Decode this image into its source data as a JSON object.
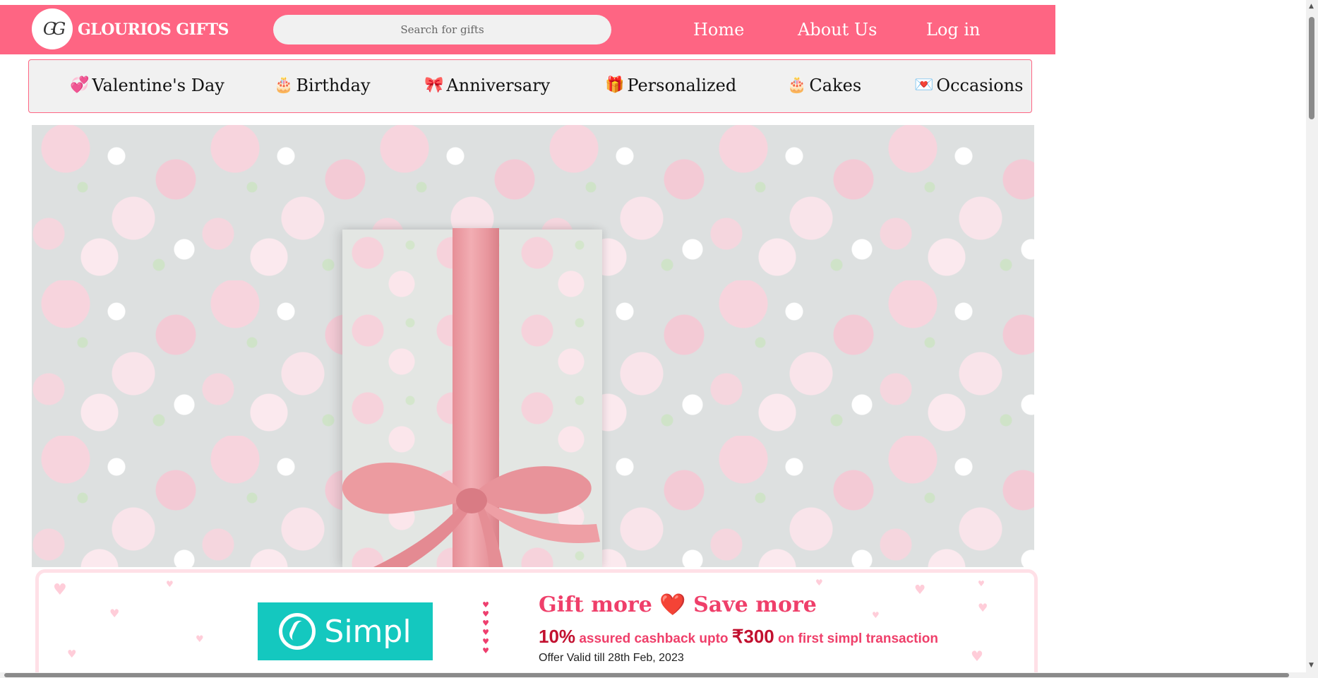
{
  "header": {
    "logo_monogram": "GG",
    "brand_name": "GLOURIOS GIFTS",
    "search_placeholder": "Search for gifts",
    "nav": [
      "Home",
      "About Us",
      "Log in"
    ]
  },
  "categories": [
    {
      "icon": "💞",
      "icon_name": "hearts-icon",
      "label": "Valentine's Day"
    },
    {
      "icon": "🎂",
      "icon_name": "cake-icon",
      "label": "Birthday"
    },
    {
      "icon": "🎀",
      "icon_name": "ribbon-icon",
      "label": "Anniversary"
    },
    {
      "icon": "🎁",
      "icon_name": "gift-icon",
      "label": "Personalized"
    },
    {
      "icon": "🎂",
      "icon_name": "cake-icon",
      "label": "Cakes"
    },
    {
      "icon": "💌",
      "icon_name": "love-letter-icon",
      "label": "Occasions"
    }
  ],
  "hero": {
    "image_name": "gift-box-with-pink-ribbon-on-floral-background"
  },
  "promo": {
    "simpl_logo_text": "Simpl",
    "title_left": "Gift more",
    "title_heart": "❤️",
    "title_right": "Save more",
    "cashback_percent": "10%",
    "cashback_text": "assured cashback upto",
    "cashback_amount": "₹300",
    "cashback_suffix": "on first simpl transaction",
    "valid_text": "Offer Valid till 28th Feb, 2023"
  },
  "colors": {
    "brand_pink": "#fe6583",
    "category_bg": "#f1f1f1",
    "simpl_teal": "#14c8bf",
    "promo_pink": "#ef3f6a"
  }
}
